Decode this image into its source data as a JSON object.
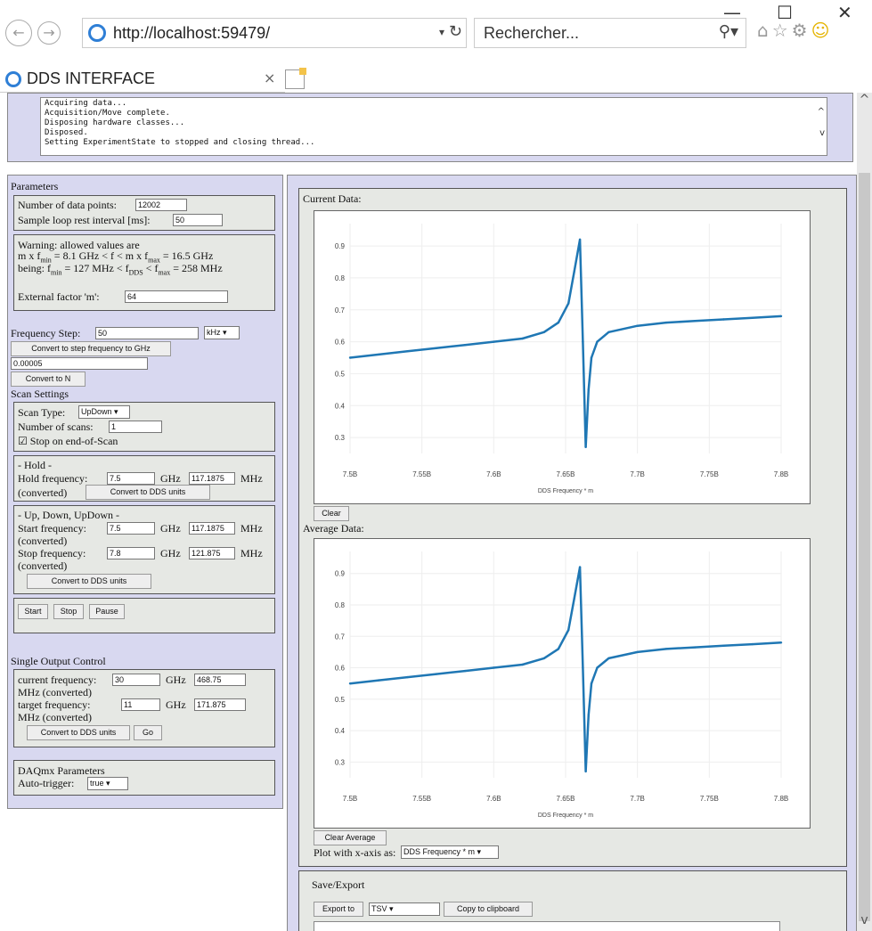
{
  "browser": {
    "url": "http://localhost:59479/",
    "search_placeholder": "Rechercher...",
    "tab_title": "DDS INTERFACE",
    "window_minimize": "—",
    "window_maximize": "☐",
    "window_close": "✕"
  },
  "log": {
    "lines": [
      "Acquiring data...",
      "Acquisition/Move complete.",
      "Disposing hardware classes...",
      "Disposed.",
      "Setting ExperimentState to stopped and closing thread..."
    ]
  },
  "params": {
    "title": "Parameters",
    "num_points_label": "Number of data points:",
    "num_points_value": "12002",
    "sample_loop_label": "Sample loop rest interval [ms]:",
    "sample_loop_value": "50",
    "warning_line1": "Warning: allowed values are",
    "warning_line2": "m x f",
    "warning_line2_sub1": "min",
    "warning_line2_mid": " = 8.1 GHz < f < m x f",
    "warning_line2_sub2": "max",
    "warning_line2_end": " = 16.5 GHz",
    "warning_line3_a": "being: f",
    "warning_line3_sub1": "min",
    "warning_line3_b": " = 127 MHz < f",
    "warning_line3_sub2": "DDS",
    "warning_line3_c": " < f",
    "warning_line3_sub3": "max",
    "warning_line3_d": " = 258 MHz",
    "ext_factor_label": "External factor 'm':",
    "ext_factor_value": "64"
  },
  "freq_step": {
    "label": "Frequency Step:",
    "value": "50",
    "unit": "kHz",
    "convert_ghz_button": "Convert to step frequency to GHz",
    "ghz_value": "0.00005",
    "convert_n_button": "Convert to N"
  },
  "scan": {
    "title": "Scan Settings",
    "type_label": "Scan Type:",
    "type_value": "UpDown",
    "num_scans_label": "Number of scans:",
    "num_scans_value": "1",
    "stop_label": "Stop on end-of-Scan",
    "stop_checked": "☑"
  },
  "hold": {
    "title": "- Hold -",
    "freq_label": "Hold frequency:",
    "freq_value": "7.5",
    "ghz": "GHz",
    "mhz_value": "117.1875",
    "mhz": "MHz",
    "converted": "(converted)",
    "convert_button": "Convert to DDS units"
  },
  "updown": {
    "title": "- Up, Down, UpDown -",
    "start_label": "Start frequency:",
    "start_value": "7.5",
    "start_mhz": "117.1875",
    "stop_label": "Stop frequency:",
    "stop_value": "7.8",
    "stop_mhz": "121.875",
    "ghz": "GHz",
    "mhz": "MHz",
    "converted": "(converted)",
    "convert_button": "Convert to DDS units"
  },
  "controls": {
    "start": "Start",
    "stop": "Stop",
    "pause": "Pause"
  },
  "single": {
    "title": "Single Output Control",
    "current_label": "current frequency:",
    "current_value": "30",
    "current_mhz": "468.75",
    "target_label": "target frequency:",
    "target_value": "11",
    "target_mhz": "171.875",
    "ghz": "GHz",
    "mhz_conv": "MHz (converted)",
    "convert_button": "Convert to DDS units",
    "go_button": "Go"
  },
  "daq": {
    "title": "DAQmx Parameters",
    "trigger_label": "Auto-trigger:",
    "trigger_value": "true"
  },
  "right": {
    "current_title": "Current Data:",
    "clear_button": "Clear",
    "average_title": "Average Data:",
    "clear_avg_button": "Clear Average",
    "xaxis_label": "Plot with x-axis as:",
    "xaxis_value": "DDS Frequency * m",
    "save_title": "Save/Export",
    "export_button": "Export to",
    "format_value": "TSV",
    "copy_button": "Copy to clipboard"
  },
  "chart_data": [
    {
      "type": "line",
      "xlabel": "DDS Frequency * m",
      "ylabel": "",
      "xlim": [
        7500000000.0,
        7800000000.0
      ],
      "ylim": [
        0.25,
        0.97
      ],
      "xticks": [
        "7.5B",
        "7.55B",
        "7.6B",
        "7.65B",
        "7.7B",
        "7.75B",
        "7.8B"
      ],
      "yticks": [
        0.3,
        0.4,
        0.5,
        0.6,
        0.7,
        0.8,
        0.9
      ],
      "color": "#1f77b4",
      "x": [
        7500000000.0,
        7520000000.0,
        7540000000.0,
        7560000000.0,
        7580000000.0,
        7600000000.0,
        7620000000.0,
        7635000000.0,
        7645000000.0,
        7652000000.0,
        7656000000.0,
        7660000000.0,
        7662000000.0,
        7664000000.0,
        7666000000.0,
        7668000000.0,
        7672000000.0,
        7680000000.0,
        7700000000.0,
        7720000000.0,
        7740000000.0,
        7760000000.0,
        7780000000.0,
        7800000000.0
      ],
      "y": [
        0.55,
        0.56,
        0.57,
        0.58,
        0.59,
        0.6,
        0.61,
        0.63,
        0.66,
        0.72,
        0.82,
        0.92,
        0.6,
        0.27,
        0.45,
        0.55,
        0.6,
        0.63,
        0.65,
        0.66,
        0.665,
        0.67,
        0.675,
        0.68
      ]
    },
    {
      "type": "line",
      "xlabel": "DDS Frequency * m",
      "ylabel": "",
      "xlim": [
        7500000000.0,
        7800000000.0
      ],
      "ylim": [
        0.25,
        0.97
      ],
      "xticks": [
        "7.5B",
        "7.55B",
        "7.6B",
        "7.65B",
        "7.7B",
        "7.75B",
        "7.8B"
      ],
      "yticks": [
        0.3,
        0.4,
        0.5,
        0.6,
        0.7,
        0.8,
        0.9
      ],
      "color": "#1f77b4",
      "x": [
        7500000000.0,
        7520000000.0,
        7540000000.0,
        7560000000.0,
        7580000000.0,
        7600000000.0,
        7620000000.0,
        7635000000.0,
        7645000000.0,
        7652000000.0,
        7656000000.0,
        7660000000.0,
        7662000000.0,
        7664000000.0,
        7666000000.0,
        7668000000.0,
        7672000000.0,
        7680000000.0,
        7700000000.0,
        7720000000.0,
        7740000000.0,
        7760000000.0,
        7780000000.0,
        7800000000.0
      ],
      "y": [
        0.55,
        0.56,
        0.57,
        0.58,
        0.59,
        0.6,
        0.61,
        0.63,
        0.66,
        0.72,
        0.82,
        0.92,
        0.6,
        0.27,
        0.45,
        0.55,
        0.6,
        0.63,
        0.65,
        0.66,
        0.665,
        0.67,
        0.675,
        0.68
      ]
    }
  ]
}
